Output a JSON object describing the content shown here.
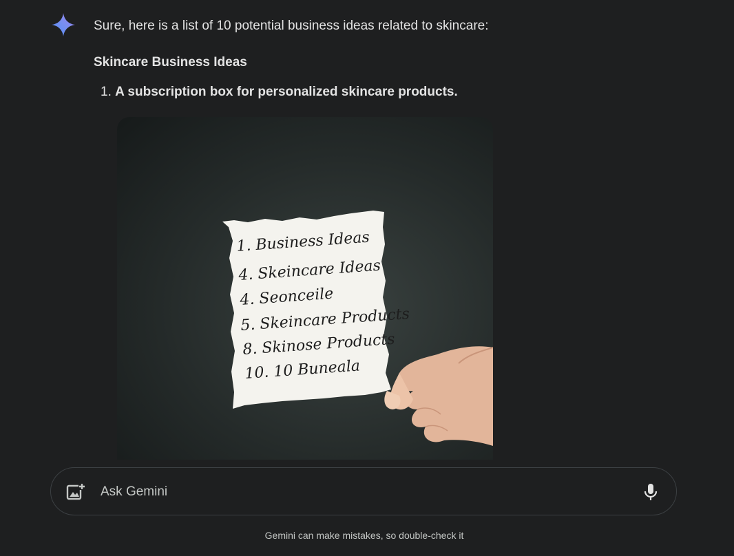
{
  "response": {
    "intro": "Sure, here is a list of 10 potential business ideas related to skincare:",
    "heading": "Skincare Business Ideas",
    "items": [
      {
        "number": "1.",
        "text": "A subscription box for personalized skincare products."
      }
    ],
    "image": {
      "note_lines": [
        "1. Business Ideas",
        "4. Skeincare Ideas",
        "4. Seonceile",
        "5. Skeincare Products",
        "8. Skinose Products",
        "10. 10 Buneala"
      ]
    }
  },
  "composer": {
    "placeholder": "Ask Gemini",
    "add_image_icon": "add-image-icon",
    "mic_icon": "microphone-icon"
  },
  "footer": {
    "disclaimer": "Gemini can make mistakes, so double-check it"
  },
  "colors": {
    "background": "#1e1f20",
    "text": "#e3e3e3",
    "muted": "#c4c7c5",
    "border": "#3c4043"
  }
}
